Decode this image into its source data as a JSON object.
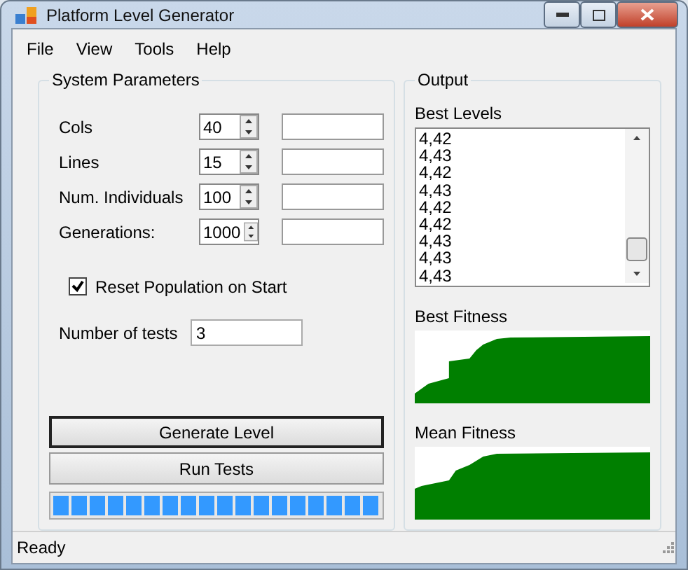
{
  "window": {
    "title": "Platform Level Generator"
  },
  "menu": [
    "File",
    "View",
    "Tools",
    "Help"
  ],
  "system_parameters": {
    "title": "System Parameters",
    "rows": [
      {
        "label": "Cols",
        "value": "40"
      },
      {
        "label": "Lines",
        "value": "15"
      },
      {
        "label": "Num. Individuals",
        "value": "100"
      },
      {
        "label": "Generations:",
        "value": "1000"
      }
    ],
    "reset_population": {
      "label": "Reset Population on Start",
      "checked": true
    },
    "tests": {
      "label": "Number of tests",
      "value": "3"
    },
    "buttons": [
      {
        "label": "Generate Level",
        "selected": true
      },
      {
        "label": "Run Tests",
        "selected": false
      }
    ],
    "progress": {
      "level": 1
    }
  },
  "output": {
    "title": "Output",
    "best_levels_label": "Best Levels",
    "best_levels": [
      "4,42",
      "4,43",
      "4,42",
      "4,43",
      "4,42",
      "4,42",
      "4,43",
      "4,43",
      "4,43"
    ],
    "best_fitness_label": "Best Fitness",
    "mean_fitness_label": "Mean Fitness"
  },
  "status_bar": "Ready"
}
